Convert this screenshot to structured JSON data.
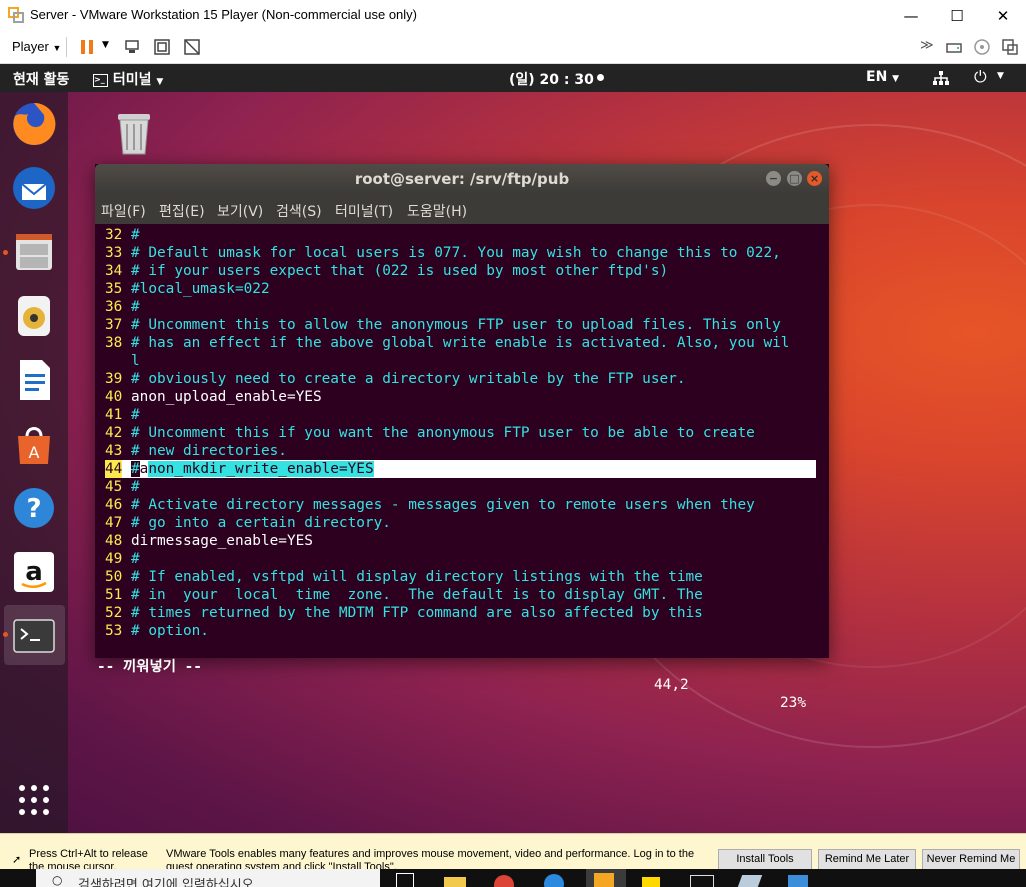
{
  "vmware": {
    "window_title": "Server - VMware Workstation 15 Player (Non-commercial use only)",
    "player_menu": "Player",
    "minimize": "—",
    "maximize": "☐",
    "close": "✕"
  },
  "ubuntu_topbar": {
    "activities": "현재 활동",
    "app_menu": "터미널",
    "clock": "(일) 20 : 30",
    "language": "EN"
  },
  "terminal": {
    "title": "root@server: /srv/ftp/pub",
    "menu": [
      "파일(F)",
      "편집(E)",
      "보기(V)",
      "검색(S)",
      "터미널(T)",
      "도움말(H)"
    ],
    "lines": [
      {
        "num": "32",
        "text": "#"
      },
      {
        "num": "33",
        "text": "# Default umask for local users is 077. You may wish to change this to 022,"
      },
      {
        "num": "34",
        "text": "# if your users expect that (022 is used by most other ftpd's)"
      },
      {
        "num": "35",
        "text": "#local_umask=022"
      },
      {
        "num": "36",
        "text": "#"
      },
      {
        "num": "37",
        "text": "# Uncomment this to allow the anonymous FTP user to upload files. This only"
      },
      {
        "num": "38",
        "text": "# has an effect if the above global write enable is activated. Also, you wil"
      },
      {
        "num": "",
        "text": "l"
      },
      {
        "num": "39",
        "text": "# obviously need to create a directory writable by the FTP user."
      },
      {
        "num": "40",
        "text": "anon_upload_enable=YES"
      },
      {
        "num": "41",
        "text": "#"
      },
      {
        "num": "42",
        "text": "# Uncomment this if you want the anonymous FTP user to be able to create"
      },
      {
        "num": "43",
        "text": "# new directories."
      },
      {
        "num": "44",
        "text": "#anon_mkdir_write_enable=YES"
      },
      {
        "num": "45",
        "text": "#"
      },
      {
        "num": "46",
        "text": "# Activate directory messages - messages given to remote users when they"
      },
      {
        "num": "47",
        "text": "# go into a certain directory."
      },
      {
        "num": "48",
        "text": "dirmessage_enable=YES"
      },
      {
        "num": "49",
        "text": "#"
      },
      {
        "num": "50",
        "text": "# If enabled, vsftpd will display directory listings with the time"
      },
      {
        "num": "51",
        "text": "# in  your  local  time  zone.  The default is to display GMT. The"
      },
      {
        "num": "52",
        "text": "# times returned by the MDTM FTP command are also affected by this"
      },
      {
        "num": "53",
        "text": "# option."
      }
    ],
    "mode": "-- 끼워넣기 --",
    "cursor_pos": "44,2",
    "percent": "23%"
  },
  "tools_bar": {
    "release_hint": "Press Ctrl+Alt to release the mouse cursor.",
    "message": "VMware Tools enables many features and improves mouse movement, video and performance. Log in to the guest operating system and click \"Install Tools\".",
    "install": "Install Tools",
    "remind_later": "Remind Me Later",
    "never_remind": "Never Remind Me"
  },
  "taskbar": {
    "search_placeholder": "검색하려면 여기에 입력하십시오."
  },
  "colors": {
    "ubuntu_orange": "#e95420",
    "terminal_bg": "#2c001e",
    "comment": "#34e2e2",
    "line_number": "#fce94f"
  }
}
